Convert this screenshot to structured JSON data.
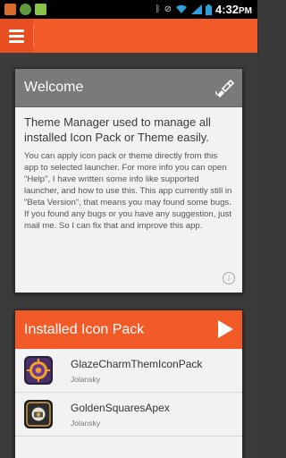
{
  "status_bar": {
    "time": "4:32",
    "meridiem": "PM",
    "left_icons": [
      "notification-icon",
      "android-icon",
      "app-icon"
    ],
    "right_icons": [
      "bluetooth-icon",
      "silent-icon",
      "wifi-icon",
      "signal-icon",
      "battery-icon"
    ]
  },
  "action_bar": {
    "menu_icon": "hamburger-menu-icon",
    "color": "#f25a27"
  },
  "welcome": {
    "title": "Welcome",
    "icon": "paint-brush-icon",
    "lead": "Theme Manager used to manage all installed Icon Pack or Theme easily.",
    "body": "You can apply icon pack or theme directly from this app to selected launcher. For more info you can open \"Help\", I have written some info like supported launcher, and how to use this. This app currently still in \"Beta Version\", that means you may found some bugs. If you found any bugs or you have any suggestion, just mail me. So I can fix that and improve this app."
  },
  "installed": {
    "title": "Installed Icon Pack",
    "icon": "play-arrow-icon",
    "items": [
      {
        "name": "GlazeCharmThemIconPack",
        "author": "Jolansky",
        "icon": "glaze-charm-icon"
      },
      {
        "name": "GoldenSquaresApex",
        "author": "Jolansky",
        "icon": "golden-squares-icon"
      }
    ]
  }
}
